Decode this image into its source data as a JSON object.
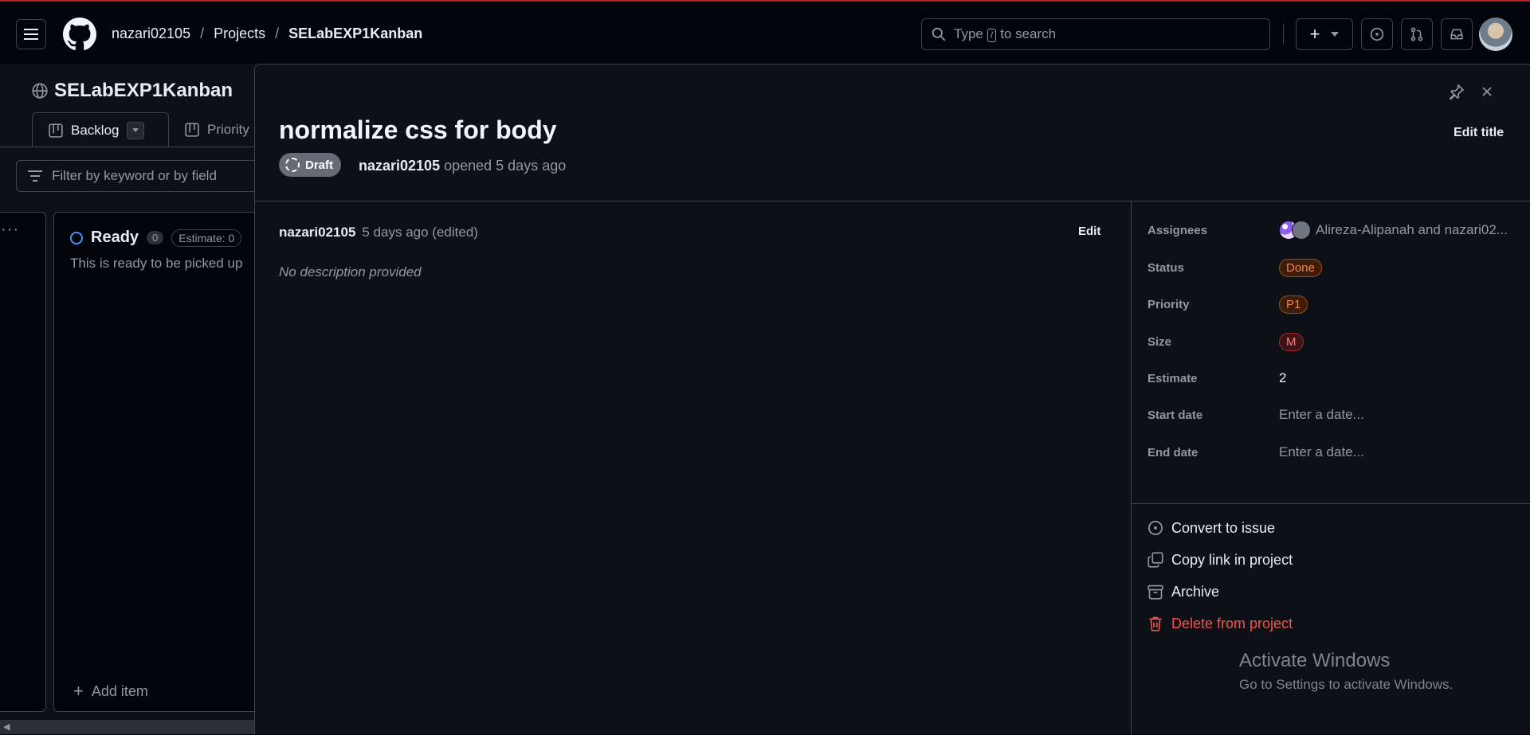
{
  "header": {
    "breadcrumbs": {
      "owner": "nazari02105",
      "sep1": "/",
      "projects": "Projects",
      "sep2": "/",
      "project": "SELabEXP1Kanban"
    },
    "search": {
      "prefix": "Type",
      "key": "/",
      "suffix": "to search"
    }
  },
  "project": {
    "title": "SELabEXP1Kanban",
    "tabs": [
      {
        "label": "Backlog"
      },
      {
        "label": "Priority"
      }
    ],
    "filter_placeholder": "Filter by keyword or by field",
    "column": {
      "name": "Ready",
      "count": "0",
      "estimate": "Estimate: 0",
      "description": "This is ready to be picked up",
      "add_item": "Add item"
    }
  },
  "panel": {
    "title": "normalize css for body",
    "badge": "Draft",
    "opened_by": "nazari02105",
    "opened_text": "opened 5 days ago",
    "edit_title": "Edit title",
    "comment": {
      "author": "nazari02105",
      "meta": "5 days ago (edited)",
      "edit": "Edit",
      "body": "No description provided"
    },
    "fields": {
      "assignees_label": "Assignees",
      "assignees_value": "Alireza-Alipanah and nazari02...",
      "status_label": "Status",
      "status_value": "Done",
      "priority_label": "Priority",
      "priority_value": "P1",
      "size_label": "Size",
      "size_value": "M",
      "estimate_label": "Estimate",
      "estimate_value": "2",
      "start_label": "Start date",
      "start_value": "Enter a date...",
      "end_label": "End date",
      "end_value": "Enter a date..."
    },
    "actions": {
      "convert": "Convert to issue",
      "copy": "Copy link in project",
      "archive": "Archive",
      "delete": "Delete from project"
    }
  },
  "watermark": {
    "line1": "Activate Windows",
    "line2": "Go to Settings to activate Windows."
  },
  "colors": {
    "accent_blue": "#4493f8",
    "danger": "#f85149",
    "orange": "#f0883e",
    "topline": "#b62324"
  }
}
